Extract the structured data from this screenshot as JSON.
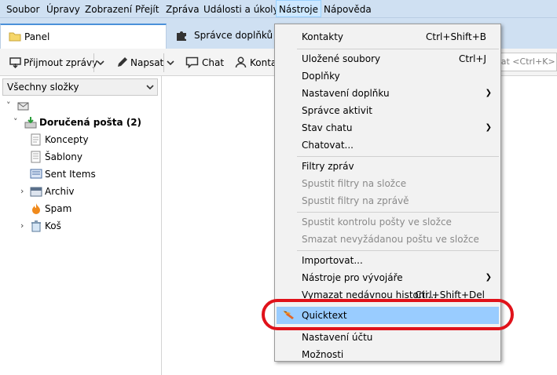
{
  "menubar": {
    "items": [
      "Soubor",
      "Úpravy",
      "Zobrazení",
      "Přejít",
      "Zpráva",
      "Události a úkoly",
      "Nástroje",
      "Nápověda"
    ]
  },
  "tabs": [
    {
      "label": "Panel"
    },
    {
      "label": "Správce doplňků"
    }
  ],
  "toolbar": {
    "get_mail": "Přijmout zprávy",
    "write": "Napsat",
    "chat": "Chat",
    "contacts": "Konta",
    "search_placeholder": "edat <Ctrl+K>"
  },
  "folders": {
    "header": "Všechny složky",
    "account": "",
    "items": [
      "Doručená pošta (2)",
      "Koncepty",
      "Šablony",
      "Sent Items",
      "Archiv",
      "Spam",
      "Koš"
    ]
  },
  "menu": {
    "items": [
      {
        "label": "Kontakty",
        "accel": "Ctrl+Shift+B"
      },
      {
        "label": "Uložené soubory",
        "accel": "Ctrl+J"
      },
      {
        "label": "Doplňky"
      },
      {
        "label": "Nastavení doplňku"
      },
      {
        "label": "Správce aktivit"
      },
      {
        "label": "Stav chatu"
      },
      {
        "label": "Chatovat..."
      },
      {
        "label": "Filtry zpráv"
      },
      {
        "label": "Spustit filtry na složce"
      },
      {
        "label": "Spustit filtry na zprávě"
      },
      {
        "label": "Spustit kontrolu pošty ve složce"
      },
      {
        "label": "Smazat nevyžádanou poštu ve složce"
      },
      {
        "label": "Importovat..."
      },
      {
        "label": "Nástroje pro vývojáře"
      },
      {
        "label": "Vymazat nedávnou historii...",
        "accel": "Ctrl+Shift+Del"
      },
      {
        "label": "Quicktext"
      },
      {
        "label": "Nastavení účtu"
      },
      {
        "label": "Možnosti"
      }
    ]
  },
  "colors": {
    "highlight": "#99ccff",
    "annotation": "#e0121a",
    "menubar_bg": "#cfe0f2"
  }
}
